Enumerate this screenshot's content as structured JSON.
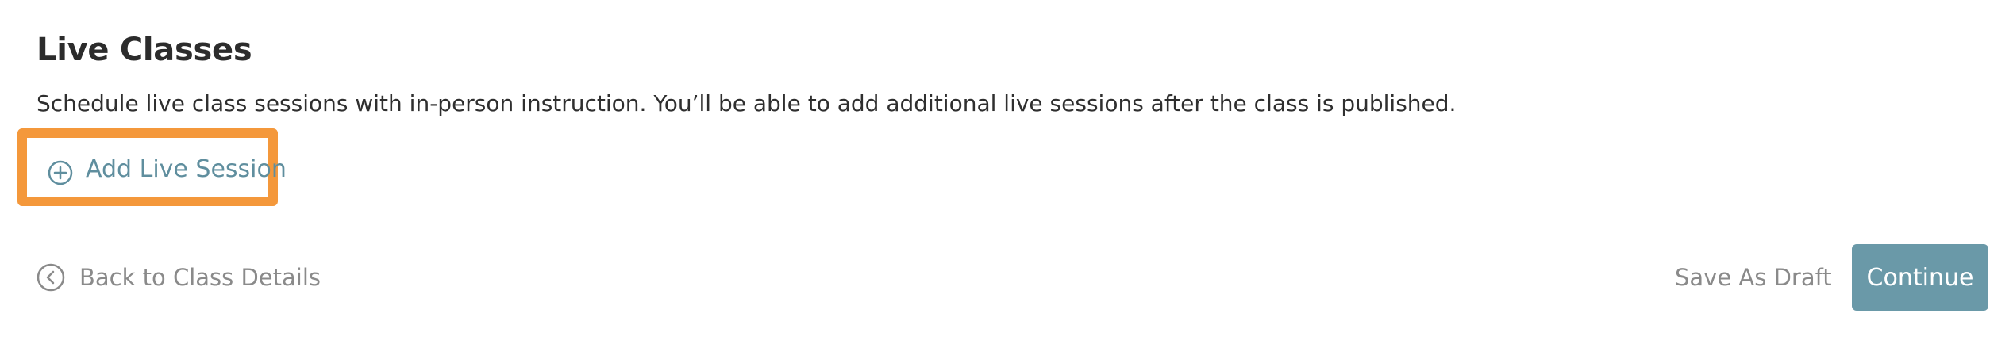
{
  "section": {
    "title": "Live Classes",
    "description": "Schedule live class sessions with in-person instruction. You’ll be able to add additional live sessions after the class is published."
  },
  "add_session": {
    "label": "Add Live Session",
    "icon": "plus-circle-icon",
    "highlight_color": "#f4983b",
    "text_color": "#5f8e9e"
  },
  "footer": {
    "back_label": "Back to Class Details",
    "back_icon": "chevron-left-circle-icon",
    "save_draft_label": "Save As Draft",
    "continue_label": "Continue",
    "continue_color": "#6a99a8"
  }
}
